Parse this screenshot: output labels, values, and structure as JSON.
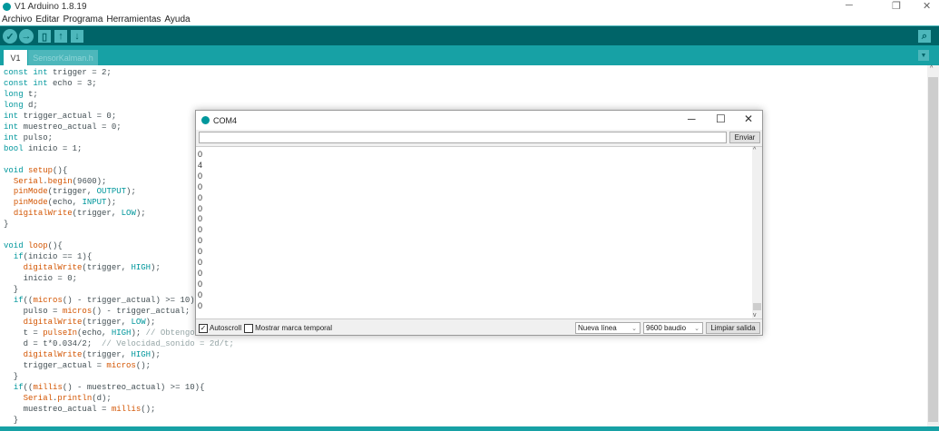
{
  "window": {
    "title": "V1 Arduino 1.8.19"
  },
  "menu": [
    "Archivo",
    "Editar",
    "Programa",
    "Herramientas",
    "Ayuda"
  ],
  "toolbar": {
    "verify": "verify-icon",
    "upload": "upload-icon",
    "new": "new-icon",
    "open": "open-icon",
    "save": "save-icon",
    "monitor": "serial-monitor-icon"
  },
  "tabs": [
    {
      "label": "V1"
    },
    {
      "label": "SensorKalman.h"
    }
  ],
  "code": [
    [
      [
        "const int",
        "k"
      ],
      [
        " trigger = 2;",
        ""
      ]
    ],
    [
      [
        "const int",
        "k"
      ],
      [
        " echo = 3;",
        ""
      ]
    ],
    [
      [
        "long",
        "k"
      ],
      [
        " t;",
        ""
      ]
    ],
    [
      [
        "long",
        "k"
      ],
      [
        " d;",
        ""
      ]
    ],
    [
      [
        "int",
        "k"
      ],
      [
        " trigger_actual = 0;",
        ""
      ]
    ],
    [
      [
        "int",
        "k"
      ],
      [
        " muestreo_actual = 0;",
        ""
      ]
    ],
    [
      [
        "int",
        "k"
      ],
      [
        " pulso;",
        ""
      ]
    ],
    [
      [
        "bool",
        "k"
      ],
      [
        " inicio = 1;",
        ""
      ]
    ],
    [],
    [
      [
        "void",
        "k"
      ],
      [
        " ",
        ""
      ],
      [
        "setup",
        "f"
      ],
      [
        "(){",
        ""
      ]
    ],
    [
      [
        "  ",
        ""
      ],
      [
        "Serial",
        "f"
      ],
      [
        ".",
        ""
      ],
      [
        "begin",
        "f"
      ],
      [
        "(9600);",
        ""
      ]
    ],
    [
      [
        "  ",
        ""
      ],
      [
        "pinMode",
        "f"
      ],
      [
        "(trigger, ",
        ""
      ],
      [
        "OUTPUT",
        "c"
      ],
      [
        ");",
        ""
      ]
    ],
    [
      [
        "  ",
        ""
      ],
      [
        "pinMode",
        "f"
      ],
      [
        "(echo, ",
        ""
      ],
      [
        "INPUT",
        "c"
      ],
      [
        ");",
        ""
      ]
    ],
    [
      [
        "  ",
        ""
      ],
      [
        "digitalWrite",
        "f"
      ],
      [
        "(trigger, ",
        ""
      ],
      [
        "LOW",
        "c"
      ],
      [
        ");",
        ""
      ]
    ],
    [
      [
        "}",
        ""
      ]
    ],
    [],
    [
      [
        "void",
        "k"
      ],
      [
        " ",
        ""
      ],
      [
        "loop",
        "f"
      ],
      [
        "(){",
        ""
      ]
    ],
    [
      [
        "  ",
        ""
      ],
      [
        "if",
        "k"
      ],
      [
        "(inicio == 1){",
        ""
      ]
    ],
    [
      [
        "    ",
        ""
      ],
      [
        "digitalWrite",
        "f"
      ],
      [
        "(trigger, ",
        ""
      ],
      [
        "HIGH",
        "c"
      ],
      [
        ");",
        ""
      ]
    ],
    [
      [
        "    inicio = 0;",
        ""
      ]
    ],
    [
      [
        "  }",
        ""
      ]
    ],
    [
      [
        "  ",
        ""
      ],
      [
        "if",
        "k"
      ],
      [
        "((",
        ""
      ],
      [
        "micros",
        "f"
      ],
      [
        "() - trigger_actual) >= 10)",
        ""
      ]
    ],
    [
      [
        "    pulso = ",
        ""
      ],
      [
        "micros",
        "f"
      ],
      [
        "() - trigger_actual;",
        ""
      ]
    ],
    [
      [
        "    ",
        ""
      ],
      [
        "digitalWrite",
        "f"
      ],
      [
        "(trigger, ",
        ""
      ],
      [
        "LOW",
        "c"
      ],
      [
        ");",
        ""
      ]
    ],
    [
      [
        "    t = ",
        ""
      ],
      [
        "pulseIn",
        "f"
      ],
      [
        "(echo, ",
        ""
      ],
      [
        "HIGH",
        "c"
      ],
      [
        "); ",
        ""
      ],
      [
        "// Obtengo",
        "m"
      ]
    ],
    [
      [
        "    d = t*0.034/2;  ",
        ""
      ],
      [
        "// Velocidad_sonido = 2d/t;",
        "m"
      ]
    ],
    [
      [
        "    ",
        ""
      ],
      [
        "digitalWrite",
        "f"
      ],
      [
        "(trigger, ",
        ""
      ],
      [
        "HIGH",
        "c"
      ],
      [
        ");",
        ""
      ]
    ],
    [
      [
        "    trigger_actual = ",
        ""
      ],
      [
        "micros",
        "f"
      ],
      [
        "();",
        ""
      ]
    ],
    [
      [
        "  }",
        ""
      ]
    ],
    [
      [
        "  ",
        ""
      ],
      [
        "if",
        "k"
      ],
      [
        "((",
        ""
      ],
      [
        "millis",
        "f"
      ],
      [
        "() - muestreo_actual) >= 10){",
        ""
      ]
    ],
    [
      [
        "    ",
        ""
      ],
      [
        "Serial",
        "f"
      ],
      [
        ".",
        ""
      ],
      [
        "println",
        "f"
      ],
      [
        "(d);",
        ""
      ]
    ],
    [
      [
        "    muestreo_actual = ",
        ""
      ],
      [
        "millis",
        "f"
      ],
      [
        "();",
        ""
      ]
    ],
    [
      [
        "  }",
        ""
      ]
    ]
  ],
  "serial": {
    "title": "COM4",
    "input": "",
    "send_label": "Enviar",
    "output": [
      "0",
      "4",
      "0",
      "0",
      "0",
      "0",
      "0",
      "0",
      "0",
      "0",
      "0",
      "0",
      "0",
      "0",
      "0"
    ],
    "autoscroll_label": "Autoscroll",
    "autoscroll_checked": true,
    "timestamp_label": "Mostrar marca temporal",
    "timestamp_checked": false,
    "line_ending": "Nueva línea",
    "baud": "9600 baudio",
    "clear_label": "Limpiar salida"
  },
  "colors": {
    "toolbar": "#006468",
    "tabbar": "#17a1a5",
    "keyword": "#00979c",
    "function": "#d35400"
  }
}
